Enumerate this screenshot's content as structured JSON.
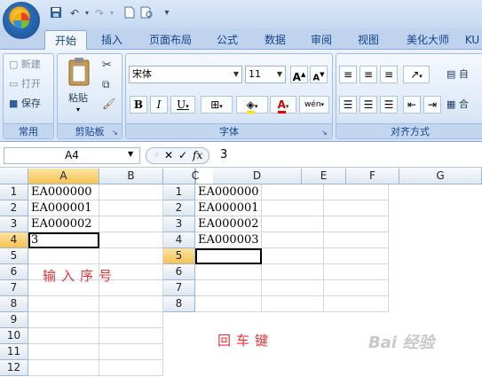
{
  "quick_access": {
    "save_icon": "floppy-icon",
    "undo_icon": "undo-icon",
    "redo_icon": "redo-icon",
    "new_icon": "new-doc-icon",
    "preview_icon": "preview-icon",
    "more": "▾"
  },
  "tabs": [
    "开始",
    "插入",
    "页面布局",
    "公式",
    "数据",
    "审阅",
    "视图",
    "美化大师",
    "KU"
  ],
  "ribbon": {
    "common": {
      "label": "常用",
      "new": "新建",
      "open": "打开",
      "save": "保存"
    },
    "clipboard": {
      "label": "剪贴板",
      "paste": "粘贴"
    },
    "font": {
      "label": "字体",
      "name": "宋体",
      "size": "11",
      "bold": "B",
      "italic": "I",
      "underline": "U",
      "grow": "A",
      "shrink": "A",
      "color_a": "A",
      "wen": "wén"
    },
    "align": {
      "label": "对齐方式",
      "auto": "自",
      "merge": "合"
    }
  },
  "formula_bar": {
    "name_box": "A4",
    "cancel": "✕",
    "enter": "✓",
    "fx": "fx",
    "value": "3"
  },
  "sheet1": {
    "columns": [
      "A",
      "B"
    ],
    "rows": [
      "1",
      "2",
      "3",
      "4",
      "5",
      "6",
      "7",
      "8",
      "9",
      "10",
      "11",
      "12"
    ],
    "cells": {
      "A1": "EA000000",
      "A2": "EA000001",
      "A3": "EA000002",
      "A4": "3"
    },
    "note": "输入序号"
  },
  "sheet2": {
    "columns": [
      "C",
      "D",
      "E",
      "F",
      "G"
    ],
    "rows": [
      "1",
      "2",
      "3",
      "4",
      "5",
      "6",
      "7",
      "8"
    ],
    "cells": {
      "D1": "EA000000",
      "D2": "EA000001",
      "D3": "EA000002",
      "D4": "EA000003"
    },
    "note": "回车键"
  },
  "watermark": "Bai 经验"
}
